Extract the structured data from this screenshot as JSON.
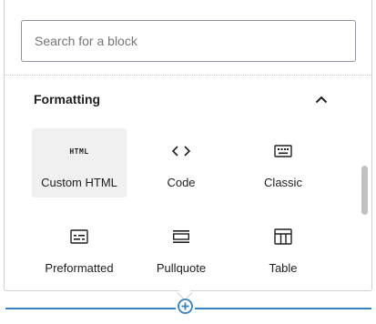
{
  "search": {
    "placeholder": "Search for a block",
    "value": ""
  },
  "category": {
    "title": "Formatting",
    "expanded": true
  },
  "blocks": [
    {
      "label": "Custom HTML",
      "icon": "html-icon",
      "glyph": "HTML",
      "active": true
    },
    {
      "label": "Code",
      "icon": "code-icon"
    },
    {
      "label": "Classic",
      "icon": "keyboard-icon"
    },
    {
      "label": "Preformatted",
      "icon": "preformatted-icon"
    },
    {
      "label": "Pullquote",
      "icon": "pullquote-icon"
    },
    {
      "label": "Table",
      "icon": "table-icon"
    }
  ],
  "colors": {
    "accent": "#3582c4",
    "text": "#1e1e1e",
    "hover_bg": "#f0f0f0"
  }
}
